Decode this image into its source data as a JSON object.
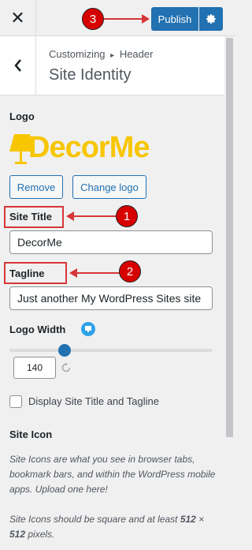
{
  "topbar": {
    "close_icon": "close-icon",
    "publish_label": "Publish",
    "gear_icon": "gear-icon"
  },
  "header": {
    "crumb_prefix": "Customizing",
    "crumb_arrow": "▸",
    "crumb_section": "Header",
    "title": "Site Identity"
  },
  "logo": {
    "label": "Logo",
    "logo_text_part1": "Decor",
    "logo_text_part2": "Me",
    "remove_label": "Remove",
    "change_label": "Change logo"
  },
  "site_title": {
    "label": "Site Title",
    "value": "DecorMe"
  },
  "tagline": {
    "label": "Tagline",
    "value": "Just another My WordPress Sites site"
  },
  "logo_width": {
    "label": "Logo Width",
    "value": "140",
    "slider_fraction": 0.27
  },
  "display_checkbox": {
    "label": "Display Site Title and Tagline",
    "checked": false
  },
  "site_icon": {
    "label": "Site Icon",
    "desc1": "Site Icons are what you see in browser tabs, bookmark bars, and within the WordPress mobile apps. Upload one here!",
    "desc2_prefix": "Site Icons should be square and at least ",
    "desc2_dim1": "512",
    "desc2_times": " × ",
    "desc2_dim2": "512",
    "desc2_suffix": " pixels."
  },
  "annotations": {
    "badge1": "1",
    "badge2": "2",
    "badge3": "3",
    "color": "#d63638"
  },
  "colors": {
    "accent": "#2271b1",
    "logo_yellow": "#f7c600"
  }
}
